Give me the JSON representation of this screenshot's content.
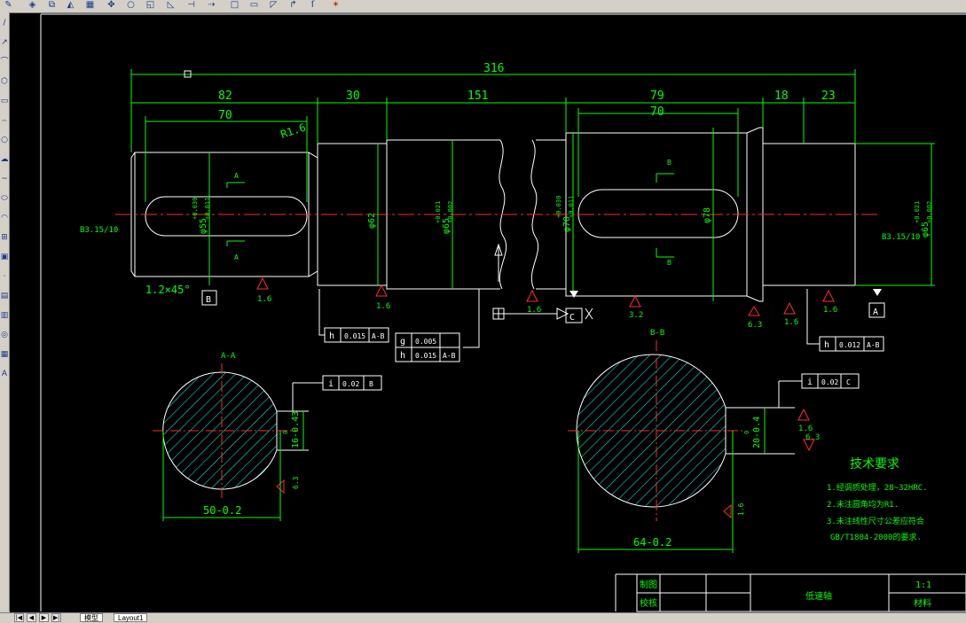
{
  "toolbar": {
    "icons": [
      "pencil-icon",
      "eraser-icon",
      "copy-icon",
      "mirror-icon",
      "offset-icon",
      "array-icon",
      "move-icon",
      "rotate-icon",
      "scale-icon",
      "stretch-icon",
      "trim-icon",
      "extend-icon",
      "break-icon",
      "join-icon",
      "chamfer-icon",
      "fillet-icon",
      "explode-icon"
    ]
  },
  "sidebar": {
    "icons": [
      "line-icon",
      "construction-line-icon",
      "polyline-icon",
      "polygon-icon",
      "rectangle-icon",
      "arc-icon",
      "circle-icon",
      "revision-cloud-icon",
      "spline-icon",
      "ellipse-icon",
      "ellipse-arc-icon",
      "insert-block-icon",
      "make-block-icon",
      "point-icon",
      "hatch-icon",
      "gradient-icon",
      "region-icon",
      "table-icon",
      "mtext-icon"
    ],
    "glyphs": [
      "/",
      "↗",
      "⌒",
      "⬡",
      "▭",
      "⌢",
      "○",
      "☁",
      "~",
      "⬭",
      "◠",
      "⊞",
      "▣",
      "·",
      "▤",
      "▥",
      "◎",
      "▦",
      "A"
    ]
  },
  "drawing": {
    "dims_top": {
      "overall": "316",
      "d82": "82",
      "d70a": "70",
      "d30": "30",
      "d151": "151",
      "d79": "79",
      "d70b": "70",
      "d18": "18",
      "d23": "23"
    },
    "radius": "R1.6",
    "diameters": {
      "phi62": "φ62",
      "phi65": "φ65",
      "phi65_tol_up": "+0.021",
      "phi65_tol_dn": "+0.002",
      "phi70": "φ70",
      "phi70_tol_up": "+0.030",
      "phi70_tol_dn": "+0.011",
      "phi78": "φ78",
      "phi55": "φ55",
      "phi55_tol_up": "+0.030",
      "phi55_tol_dn": "+0.011",
      "phi65r": "φ65",
      "phi65r_tol_up": "+0.021",
      "phi65r_tol_dn": "+0.002"
    },
    "center_hole_left": "B3.15/10",
    "center_hole_right": "B3.15/10",
    "chamfer": "1.2×45°",
    "datums": {
      "b": "B",
      "a": "A",
      "c": "C"
    },
    "section_arrows": {
      "a": "A",
      "b": "B"
    },
    "roughness": {
      "r1": "1.6",
      "r2": "1.6",
      "r3": "1.6",
      "r4": "3.2",
      "r5": "6.3",
      "r6": "1.6",
      "r7": "1.6",
      "r8": "1.6",
      "r9": "6.3",
      "r10": "1.6",
      "r11": "6.3"
    },
    "fcf1": {
      "sym": "h",
      "tol": "0.015",
      "ref": "A-B"
    },
    "fcf2a": {
      "sym": "g",
      "tol": "0.005"
    },
    "fcf2b": {
      "sym": "h",
      "tol": "0.015",
      "ref": "A-B"
    },
    "fcf3": {
      "sym": "h",
      "tol": "0.012",
      "ref": "A-B"
    },
    "fcf4": {
      "sym": "i",
      "tol": "0.02",
      "ref": "B"
    },
    "fcf5": {
      "sym": "i",
      "tol": "0.02",
      "ref": "C"
    },
    "section_aa": {
      "title": "A-A",
      "width": "50-0.2",
      "key": "16-0.43",
      "key_tol": "0"
    },
    "section_bb": {
      "title": "B-B",
      "width": "64-0.2",
      "key": "20-0.4",
      "key_tol": "0"
    },
    "tech": {
      "title": "技术要求",
      "line1": "1.经调质处理，28~32HRC.",
      "line2": "2.未注圆角均为R1.",
      "line3": "3.未注线性尺寸公差应符合",
      "line4": "GB/T1804-2000的要求."
    },
    "title_block": {
      "drawn": "制图",
      "checked": "校核",
      "name": "低速轴",
      "scale": "1:1",
      "material": "材料"
    }
  },
  "bottombar": {
    "tab_model": "模型",
    "tab_layout": "Layout1"
  }
}
